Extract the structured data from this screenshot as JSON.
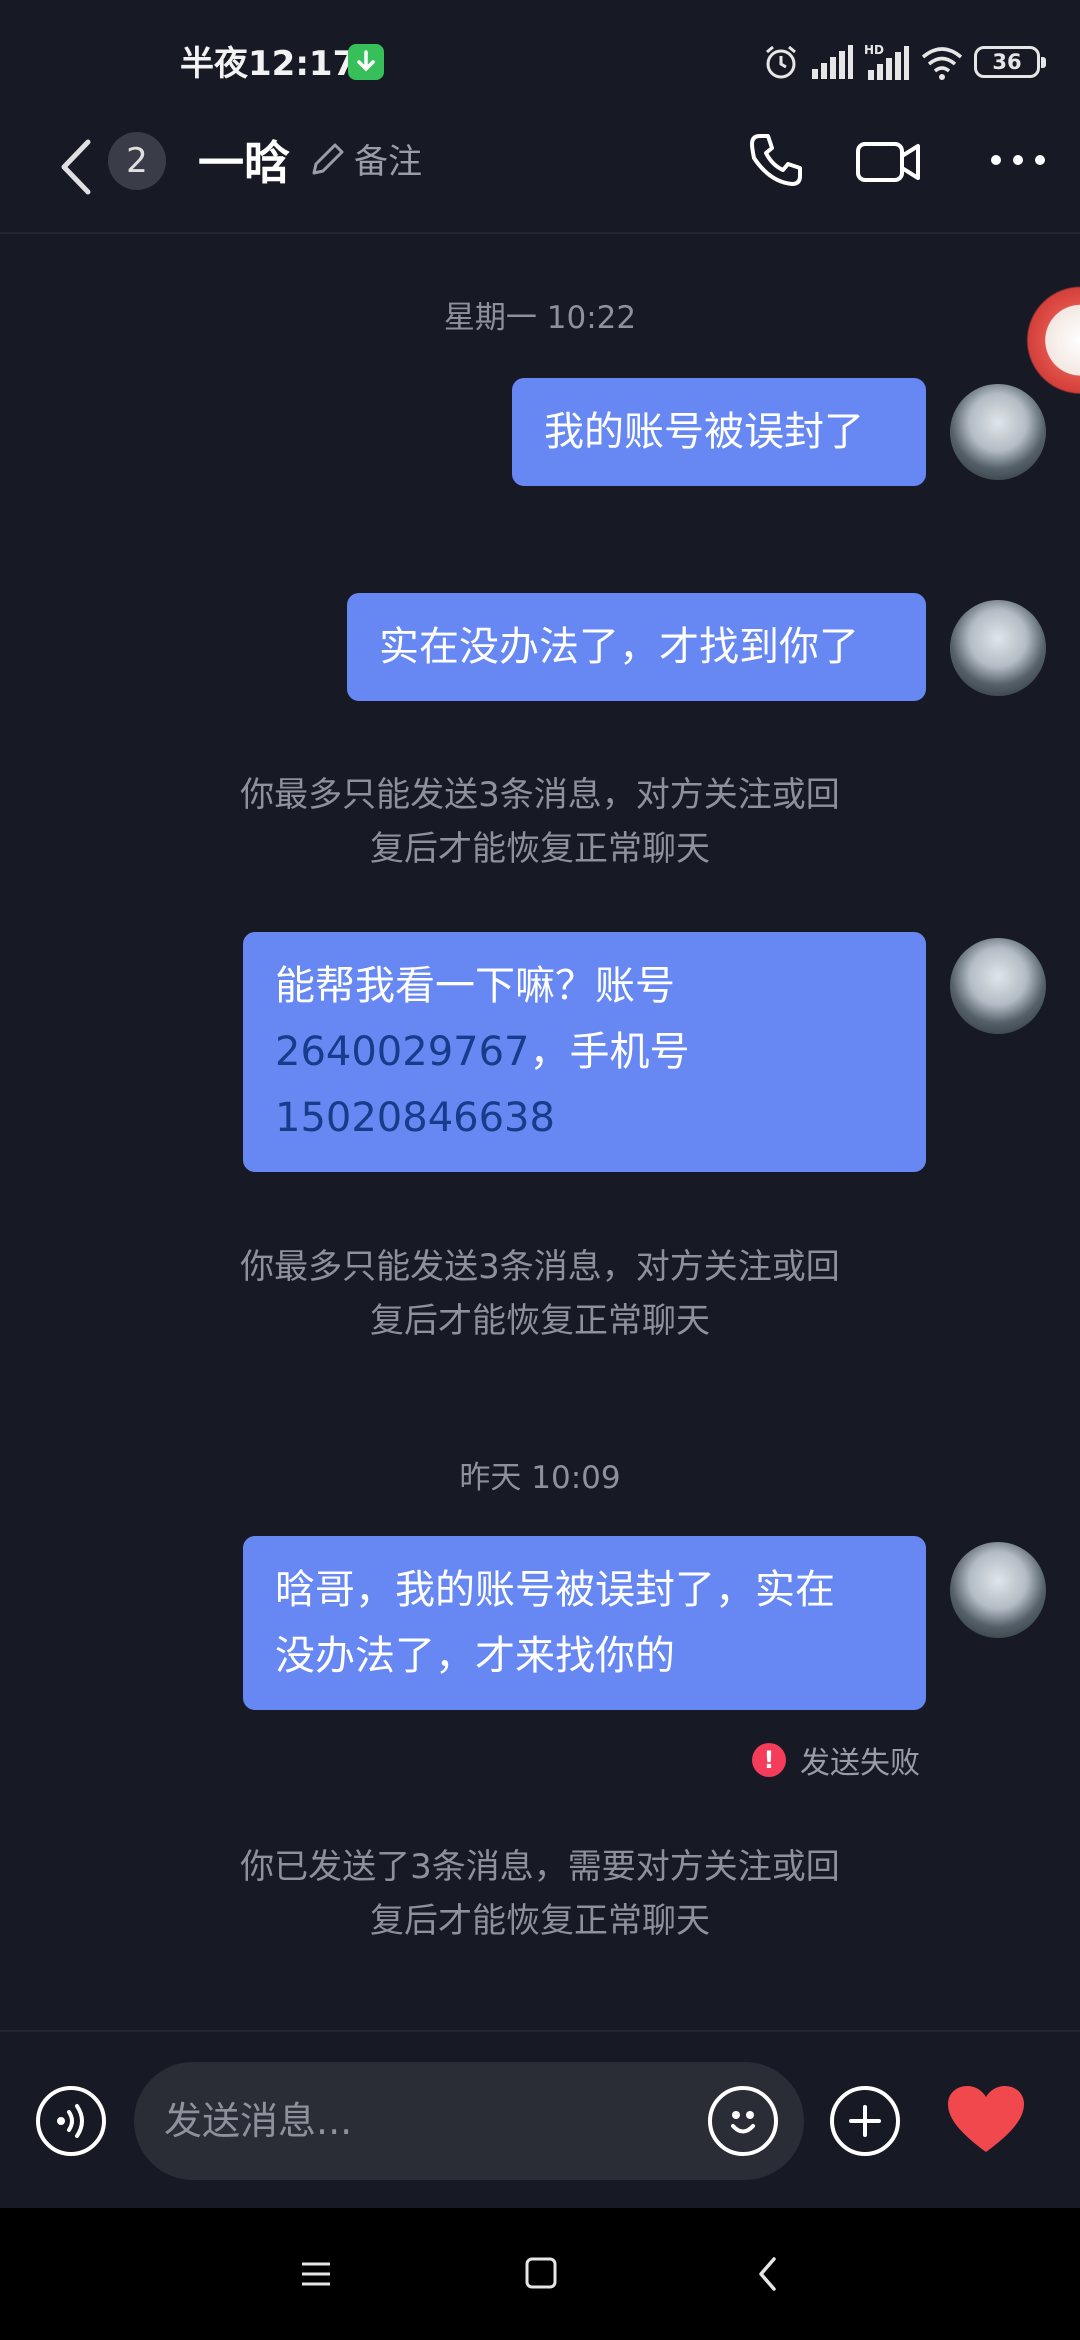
{
  "status_bar": {
    "time": "半夜12:17",
    "battery": "36",
    "network": "HD"
  },
  "header": {
    "unread_count": "2",
    "contact_name": "一晗",
    "remark_label": "备注"
  },
  "messages": [
    {
      "type": "time",
      "text": "星期一 10:22"
    },
    {
      "type": "sent",
      "text": "我的账号被误封了"
    },
    {
      "type": "sent",
      "text": "实在没办法了，才找到你了"
    },
    {
      "type": "system",
      "lines": [
        "你最多只能发送3条消息，对方关注或回",
        "复后才能恢复正常聊天"
      ]
    },
    {
      "type": "sent",
      "parts": [
        "能帮我看一下嘛？账号",
        "2640029767",
        "，手机号",
        "15020846638"
      ]
    },
    {
      "type": "system",
      "lines": [
        "你最多只能发送3条消息，对方关注或回",
        "复后才能恢复正常聊天"
      ]
    },
    {
      "type": "time",
      "text": "昨天 10:09"
    },
    {
      "type": "sent",
      "lines": [
        "晗哥，我的账号被误封了，实在",
        "没办法了，才来找你的"
      ],
      "status": "发送失败"
    },
    {
      "type": "system",
      "lines": [
        "你已发送了3条消息，需要对方关注或回",
        "复后才能恢复正常聊天"
      ]
    }
  ],
  "input": {
    "placeholder": "发送消息..."
  },
  "icons": {
    "back": "chevron-left-icon",
    "remark": "pencil-icon",
    "call": "phone-icon",
    "video": "video-camera-icon",
    "more": "more-dots-icon",
    "voice": "voice-icon",
    "emoji": "emoji-icon",
    "add": "plus-icon",
    "like": "heart-icon"
  },
  "colors": {
    "background": "#171925",
    "bubble": "#6788f2",
    "link_number": "#173c8a",
    "fail": "#f53c5b",
    "heart": "#f0484d"
  }
}
